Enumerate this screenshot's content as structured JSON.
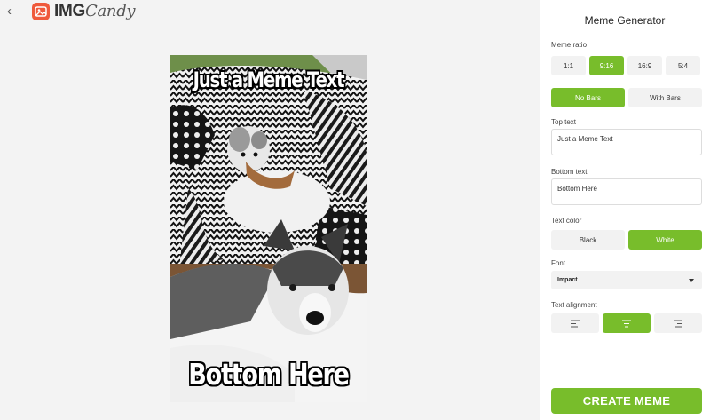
{
  "brand": {
    "name_main": "IMG",
    "name_accent": "Candy"
  },
  "meme": {
    "top_text": "Just a Meme Text",
    "bottom_text": "Bottom Here"
  },
  "panel": {
    "title": "Meme Generator",
    "ratio": {
      "label": "Meme ratio",
      "options": [
        "1:1",
        "9:16",
        "16:9",
        "5:4"
      ],
      "selected": "9:16"
    },
    "bars": {
      "options": [
        "No Bars",
        "With Bars"
      ],
      "selected": "No Bars"
    },
    "top_text": {
      "label": "Top text",
      "value": "Just a Meme Text"
    },
    "bottom_text": {
      "label": "Bottom text",
      "value": "Bottom Here"
    },
    "text_color": {
      "label": "Text color",
      "options": [
        "Black",
        "White"
      ],
      "selected": "White"
    },
    "font": {
      "label": "Font",
      "value": "Impact"
    },
    "alignment": {
      "label": "Text alignment",
      "options": [
        "left",
        "center",
        "right"
      ],
      "selected": "center"
    },
    "create_label": "CREATE MEME"
  },
  "colors": {
    "accent": "#78bd2b",
    "brand": "#ef5a3c"
  }
}
